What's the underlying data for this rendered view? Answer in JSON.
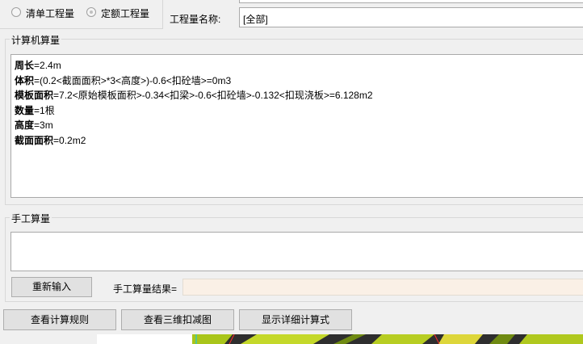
{
  "mode": {
    "option_list": "清单工程量",
    "option_quota": "定额工程量"
  },
  "quantity_name": {
    "label": "工程量名称:",
    "value": "[全部]"
  },
  "computer_calc": {
    "title": "计算机算量",
    "lines": [
      {
        "key": "周长",
        "expr": "=2.4m"
      },
      {
        "key": "体积",
        "expr": "=(0.2<截面面积>*3<高度>)-0.6<扣砼墙>=0m3"
      },
      {
        "key": "模板面积",
        "expr": "=7.2<原始模板面积>-0.34<扣梁>-0.6<扣砼墙>-0.132<扣现浇板>=6.128m2"
      },
      {
        "key": "数量",
        "expr": "=1根"
      },
      {
        "key": "高度",
        "expr": "=3m"
      },
      {
        "key": "截面面积",
        "expr": "=0.2m2"
      }
    ]
  },
  "manual_calc": {
    "title": "手工算量",
    "input_value": "",
    "reenter_button": "重新输入",
    "result_label": "手工算量结果=",
    "result_value": ""
  },
  "bottom_buttons": {
    "rules": "查看计算规则",
    "view3d": "查看三维扣减图",
    "detail": "显示详细计算式"
  },
  "colors": {
    "window_bg": "#f0f0f0",
    "result_field_bg": "#faf0e6",
    "scene_green": "#a9c51a"
  }
}
